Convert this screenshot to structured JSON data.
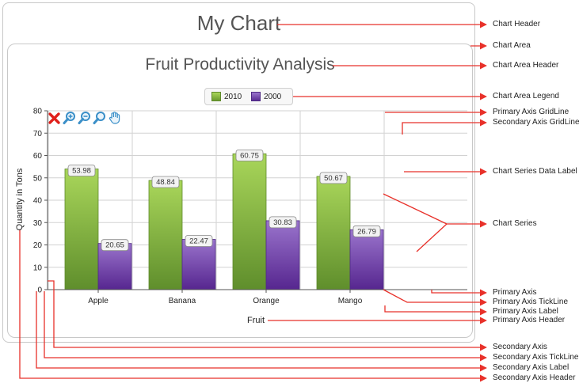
{
  "chart": {
    "header": "My Chart",
    "area_header": "Fruit Productivity Analysis"
  },
  "chart_data": {
    "type": "bar",
    "categories": [
      "Apple",
      "Banana",
      "Orange",
      "Mango"
    ],
    "series": [
      {
        "name": "2010",
        "values": [
          53.98,
          48.84,
          60.75,
          50.67
        ],
        "color": "#8cc63f"
      },
      {
        "name": "2000",
        "values": [
          20.65,
          22.47,
          30.83,
          26.79
        ],
        "color": "#7b4fb0"
      }
    ],
    "xlabel": "Fruit",
    "ylabel": "Quantity in Tons",
    "ylim": [
      0,
      80
    ],
    "yticks": [
      0,
      10,
      20,
      30,
      40,
      50,
      60,
      70,
      80
    ],
    "grid": true,
    "legend_position": "top"
  },
  "toolbar": {
    "icons": [
      "close-icon",
      "zoom-in-icon",
      "zoom-out-icon",
      "zoom-reset-icon",
      "pan-hand-icon"
    ]
  },
  "callouts": {
    "chart_header": "Chart Header",
    "chart_area": "Chart Area",
    "chart_area_header": "Chart Area Header",
    "chart_area_legend": "Chart Area Legend",
    "primary_gridline": "Primary Axis GridLine",
    "secondary_gridline": "Secondary Axis GridLine",
    "data_label": "Chart Series Data Label",
    "chart_series": "Chart Series",
    "primary_axis": "Primary Axis",
    "primary_tickline": "Primary Axis TickLine",
    "primary_label": "Primary Axis Label",
    "primary_header": "Primary Axis Header",
    "secondary_axis": "Secondary Axis",
    "secondary_tickline": "Secondary Axis TickLine",
    "secondary_label": "Secondary Axis Label",
    "secondary_header": "Secondary Axis Header"
  },
  "colors": {
    "annotation": "#e8312a",
    "border": "#c8c8c8",
    "text": "#555555"
  }
}
